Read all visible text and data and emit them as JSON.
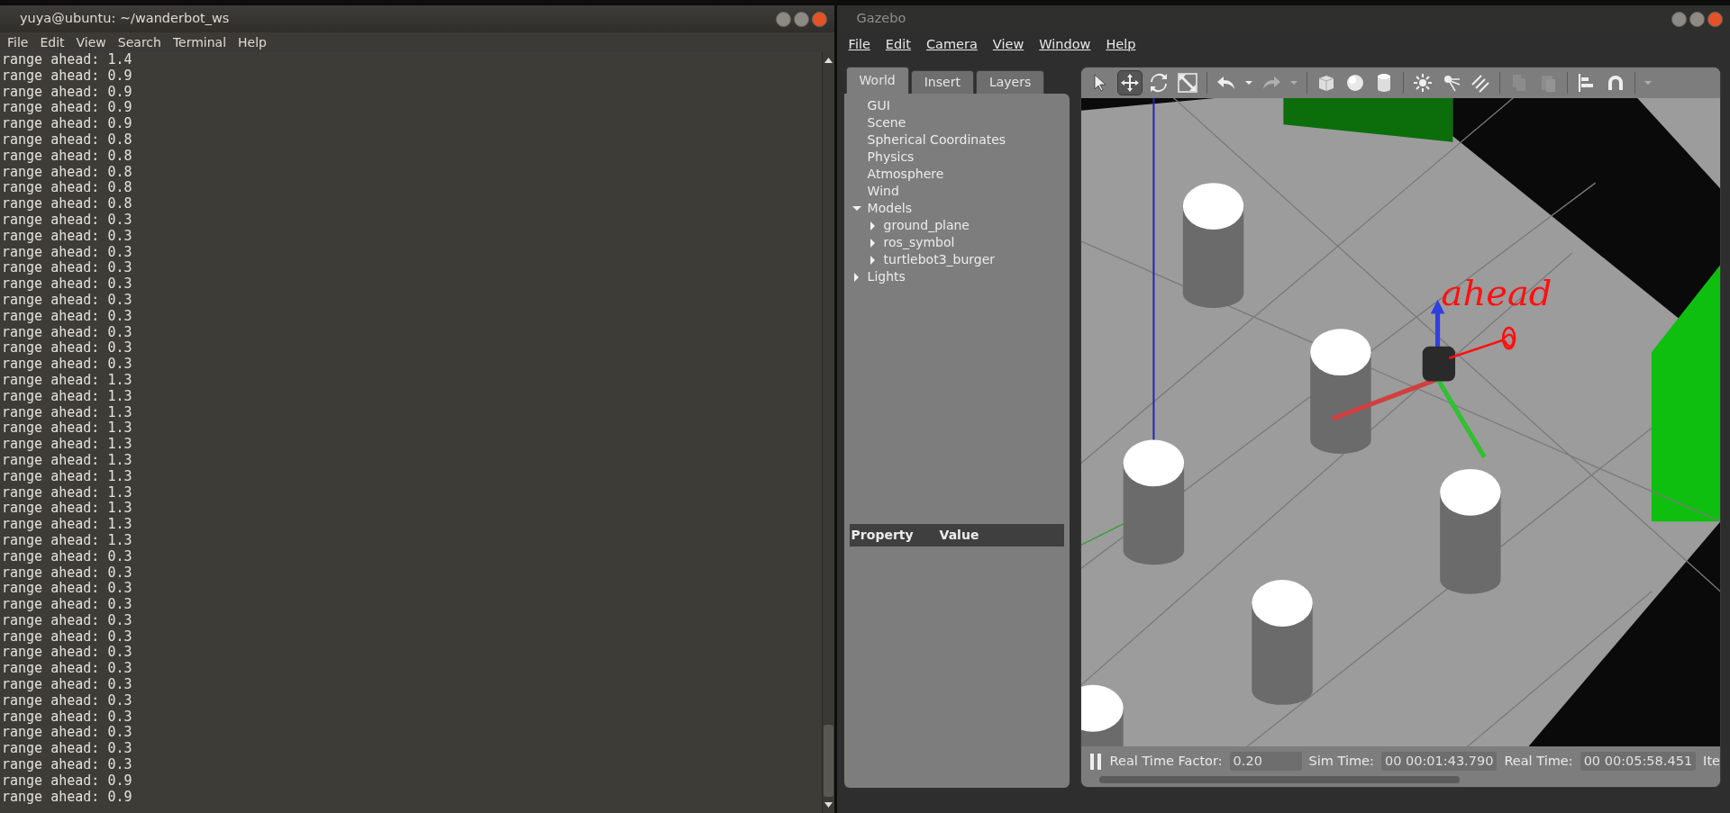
{
  "terminal": {
    "title": "yuya@ubuntu: ~/wanderbot_ws",
    "menu": [
      "File",
      "Edit",
      "View",
      "Search",
      "Terminal",
      "Help"
    ],
    "lines": [
      "range ahead: 1.4",
      "range ahead: 0.9",
      "range ahead: 0.9",
      "range ahead: 0.9",
      "range ahead: 0.9",
      "range ahead: 0.8",
      "range ahead: 0.8",
      "range ahead: 0.8",
      "range ahead: 0.8",
      "range ahead: 0.8",
      "range ahead: 0.3",
      "range ahead: 0.3",
      "range ahead: 0.3",
      "range ahead: 0.3",
      "range ahead: 0.3",
      "range ahead: 0.3",
      "range ahead: 0.3",
      "range ahead: 0.3",
      "range ahead: 0.3",
      "range ahead: 0.3",
      "range ahead: 1.3",
      "range ahead: 1.3",
      "range ahead: 1.3",
      "range ahead: 1.3",
      "range ahead: 1.3",
      "range ahead: 1.3",
      "range ahead: 1.3",
      "range ahead: 1.3",
      "range ahead: 1.3",
      "range ahead: 1.3",
      "range ahead: 1.3",
      "range ahead: 0.3",
      "range ahead: 0.3",
      "range ahead: 0.3",
      "range ahead: 0.3",
      "range ahead: 0.3",
      "range ahead: 0.3",
      "range ahead: 0.3",
      "range ahead: 0.3",
      "range ahead: 0.3",
      "range ahead: 0.3",
      "range ahead: 0.3",
      "range ahead: 0.3",
      "range ahead: 0.3",
      "range ahead: 0.3",
      "range ahead: 0.9",
      "range ahead: 0.9"
    ]
  },
  "gazebo": {
    "title": "Gazebo",
    "menu": [
      "File",
      "Edit",
      "Camera",
      "View",
      "Window",
      "Help"
    ],
    "tabs": [
      {
        "label": "World",
        "selected": true
      },
      {
        "label": "Insert",
        "selected": false
      },
      {
        "label": "Layers",
        "selected": false
      }
    ],
    "tree": [
      {
        "label": "GUI"
      },
      {
        "label": "Scene"
      },
      {
        "label": "Spherical Coordinates"
      },
      {
        "label": "Physics"
      },
      {
        "label": "Atmosphere"
      },
      {
        "label": "Wind"
      },
      {
        "label": "Models",
        "expanded": true,
        "children": [
          {
            "label": "ground_plane",
            "expanded": false
          },
          {
            "label": "ros_symbol",
            "expanded": false
          },
          {
            "label": "turtlebot3_burger",
            "expanded": false
          }
        ]
      },
      {
        "label": "Lights",
        "expanded": false
      }
    ],
    "property_columns": [
      "Property",
      "Value"
    ],
    "toolbar": [
      {
        "kind": "select",
        "selected": false,
        "disabled": false
      },
      {
        "kind": "translate",
        "selected": true,
        "disabled": false
      },
      {
        "kind": "rotate",
        "selected": false,
        "disabled": false
      },
      {
        "kind": "scale",
        "selected": false,
        "disabled": false
      },
      {
        "kind": "undo",
        "selected": false,
        "disabled": false
      },
      {
        "kind": "caret",
        "selected": false,
        "disabled": false
      },
      {
        "kind": "redo",
        "selected": false,
        "disabled": true
      },
      {
        "kind": "caret",
        "selected": false,
        "disabled": true
      },
      {
        "kind": "box",
        "selected": false,
        "disabled": false
      },
      {
        "kind": "sphere",
        "selected": false,
        "disabled": false
      },
      {
        "kind": "cylinder",
        "selected": false,
        "disabled": false
      },
      {
        "kind": "pointlight",
        "selected": false,
        "disabled": false
      },
      {
        "kind": "spotlight",
        "selected": false,
        "disabled": false
      },
      {
        "kind": "dirlight",
        "selected": false,
        "disabled": false
      },
      {
        "kind": "copy",
        "selected": false,
        "disabled": true
      },
      {
        "kind": "paste",
        "selected": false,
        "disabled": true
      },
      {
        "kind": "align",
        "selected": false,
        "disabled": false
      },
      {
        "kind": "magnet",
        "selected": false,
        "disabled": false
      },
      {
        "kind": "caret",
        "selected": false,
        "disabled": true
      }
    ],
    "annotation": "ahead",
    "status": [
      {
        "label": "Real Time Factor:",
        "value": "0.20"
      },
      {
        "label": "Sim Time:",
        "value": "00 00:01:43.790"
      },
      {
        "label": "Real Time:",
        "value": "00 00:05:58.451"
      }
    ],
    "status_cut": "Ite"
  }
}
